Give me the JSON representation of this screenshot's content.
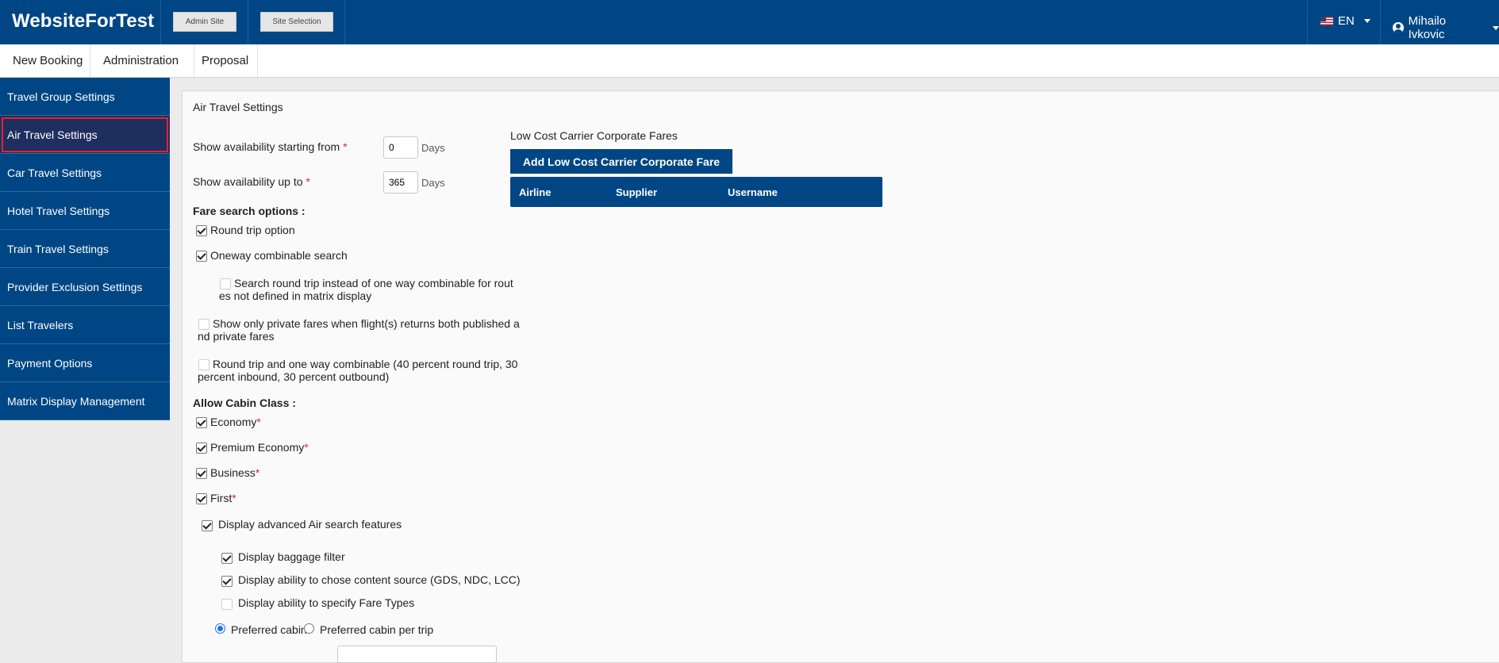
{
  "header": {
    "brand": "WebsiteForTest",
    "admin_site": "Admin Site",
    "site_selection": "Site Selection",
    "language": "EN",
    "language_flag_icon": "us-flag-icon",
    "user_name": "Mihailo Ivkovic",
    "user_icon": "user-circle-icon"
  },
  "nav": {
    "items": [
      "New Booking",
      "Administration",
      "Proposal"
    ]
  },
  "sidebar": {
    "items": [
      {
        "label": "Travel Group Settings",
        "active": false
      },
      {
        "label": "Air Travel Settings",
        "active": true
      },
      {
        "label": "Car Travel Settings",
        "active": false
      },
      {
        "label": "Hotel Travel Settings",
        "active": false
      },
      {
        "label": "Train Travel Settings",
        "active": false
      },
      {
        "label": "Provider Exclusion Settings",
        "active": false
      },
      {
        "label": "List Travelers",
        "active": false
      },
      {
        "label": "Payment Options",
        "active": false
      },
      {
        "label": "Matrix Display Management",
        "active": false
      }
    ]
  },
  "main": {
    "title": "Air Travel Settings",
    "avail_from": {
      "label": "Show availability starting from",
      "value": "0",
      "unit": "Days"
    },
    "avail_to": {
      "label": "Show availability up to",
      "value": "365",
      "unit": "Days"
    },
    "fare_options": {
      "heading": "Fare search options :",
      "round_trip": {
        "label": "Round trip option",
        "checked": true
      },
      "oneway_combinable": {
        "label": "Oneway combinable search",
        "checked": true
      },
      "search_round_trip": {
        "label": "Search round trip instead of one way combinable for rout",
        "label_cont": "es not defined in matrix display",
        "checked": false
      },
      "private_fares": {
        "label": "Show only private fares when flight(s) returns both published a",
        "label_cont": "nd private fares",
        "checked": false
      },
      "rt_ow_combinable": {
        "label": "Round trip and one way combinable (40 percent round trip, 30",
        "label_cont": "percent inbound, 30 percent outbound)",
        "checked": false
      }
    },
    "cabin": {
      "heading": "Allow Cabin Class :",
      "economy": {
        "label": "Economy",
        "checked": true
      },
      "premium_economy": {
        "label": "Premium Economy",
        "checked": true
      },
      "business": {
        "label": "Business",
        "checked": true
      },
      "first": {
        "label": "First",
        "checked": true
      },
      "required_mark": "*"
    },
    "advanced": {
      "label": "Display advanced Air search features",
      "checked": true,
      "baggage_filter": {
        "label": "Display baggage filter",
        "checked": true
      },
      "content_source": {
        "label": "Display ability to chose content source (GDS, NDC, LCC)",
        "checked": true
      },
      "fare_types": {
        "label": "Display ability to specify Fare Types",
        "checked": false
      }
    },
    "cabin_pref": {
      "preferred_cabin": {
        "label": "Preferred cabin",
        "selected": true
      },
      "preferred_per_trip": {
        "label": "Preferred cabin per trip",
        "selected": false
      }
    },
    "lcc": {
      "title": "Low Cost Carrier Corporate Fares",
      "add_button": "Add Low Cost Carrier Corporate Fare",
      "columns": [
        "Airline",
        "Supplier",
        "Username"
      ]
    }
  },
  "colors": {
    "primary": "#004684",
    "active_sidebar": "#1e2e5f",
    "highlight_border": "#e3232c",
    "required": "#e3232c",
    "radio_selected": "#1a73e8"
  }
}
